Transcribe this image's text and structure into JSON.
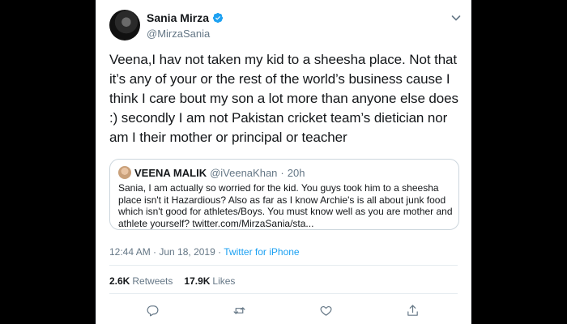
{
  "tweet": {
    "author": {
      "name": "Sania Mirza",
      "handle": "@MirzaSania",
      "verified": true
    },
    "text": "Veena,I hav not taken my kid to a sheesha place. Not that it’s any of your or the rest of the world’s business cause I think I care bout my son a lot more than anyone else does :) secondly I am not Pakistan cricket team’s dietician nor am I their mother or principal or teacher",
    "quoted": {
      "name": "VEENA MALIK",
      "handle": "@iVeenaKhan",
      "separator": "·",
      "time": "20h",
      "text": "Sania, I am actually so worried for the kid. You guys took him to a sheesha place isn't it Hazardious? Also as far as I know Archie's is all about junk food which isn't good for athletes/Boys. You must know well as you are mother and athlete yourself? twitter.com/MirzaSania/sta..."
    },
    "timestamp": "12:44 AM · Jun 18, 2019",
    "source": "Twitter for iPhone",
    "stats": {
      "retweets_count": "2.6K",
      "retweets_label": "Retweets",
      "likes_count": "17.9K",
      "likes_label": "Likes"
    },
    "actions": [
      "reply-icon",
      "retweet-icon",
      "like-icon",
      "share-icon"
    ],
    "colors": {
      "accent": "#1da1f2",
      "text": "#14171a",
      "muted": "#657786",
      "border": "#e6ecf0"
    }
  }
}
